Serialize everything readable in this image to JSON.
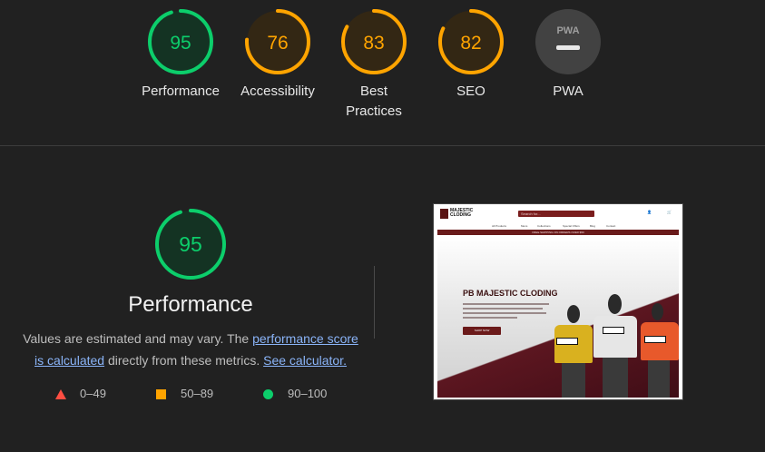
{
  "categories": [
    {
      "score": "95",
      "value": 95,
      "label": "Performance",
      "color": "#0cce6b",
      "track": "#0d3a24",
      "bg": "#143323"
    },
    {
      "score": "76",
      "value": 76,
      "label": "Accessibility",
      "color": "#ffa400",
      "track": "#4a3410",
      "bg": "#332714"
    },
    {
      "score": "83",
      "value": 83,
      "label": "Best Practices",
      "color": "#ffa400",
      "track": "#4a3410",
      "bg": "#332714"
    },
    {
      "score": "82",
      "value": 82,
      "label": "SEO",
      "color": "#ffa400",
      "track": "#4a3410",
      "bg": "#332714"
    },
    {
      "score": "PWA",
      "value": 0,
      "label": "PWA",
      "color": "#9e9e9e",
      "track": "#424242",
      "bg": "#424242"
    }
  ],
  "main": {
    "score": "95",
    "value": 95,
    "title": "Performance",
    "desc_before": "Values are estimated and may vary. The ",
    "link_score": "performance score is calculated",
    "desc_middle": " directly from these metrics. ",
    "link_calc": "See calculator."
  },
  "legend": [
    {
      "range": "0–49",
      "shape": "triangle",
      "color": "#ff4e42"
    },
    {
      "range": "50–89",
      "shape": "square",
      "color": "#ffa400"
    },
    {
      "range": "90–100",
      "shape": "circle",
      "color": "#0cce6b"
    }
  ],
  "screenshot": {
    "logo_line1": "MAJESTIC",
    "logo_line2": "CLODING",
    "search_placeholder": "Search for...",
    "icon_account": "My Account",
    "icon_cart": "Cart",
    "nav": [
      "All Products",
      "Mens",
      "Collections",
      "Special Offers",
      "Blog",
      "Contact"
    ],
    "banner": "FREE SHIPPING ON ORDERS OVER $50",
    "hero_title": "PB MAJESTIC CLODING",
    "hero_button": "SHOP NOW",
    "shirt_colors": [
      "#d9b11f",
      "#e6e6e6",
      "#e8592b"
    ]
  }
}
